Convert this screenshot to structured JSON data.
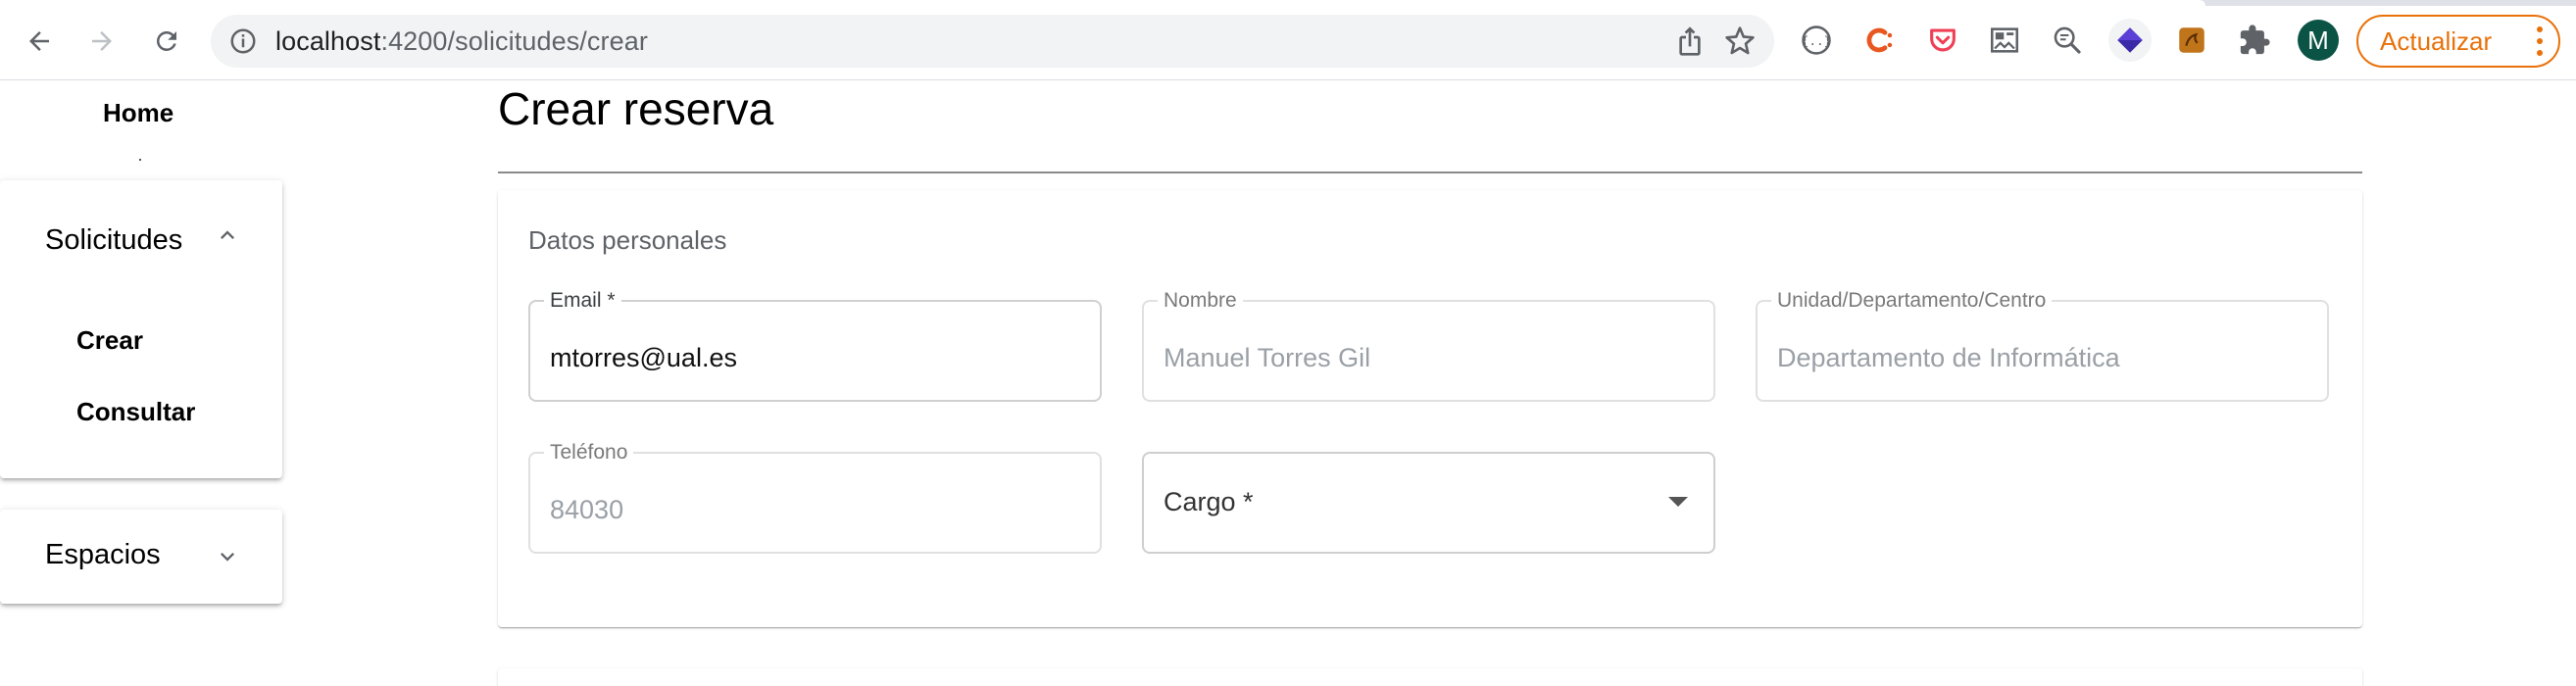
{
  "browser": {
    "url_host": "localhost",
    "url_path": ":4200/solicitudes/crear",
    "profile_initial": "M",
    "update_label": "Actualizar",
    "extensions": [
      "code-braces-icon",
      "clockify-icon",
      "pocket-icon",
      "gallery-icon",
      "zoom-text-icon",
      "diamond-icon",
      "amber-icon",
      "puzzle-icon"
    ],
    "accent_color": "#e8710a",
    "profile_color": "#0b5345"
  },
  "sidebar": {
    "home_label": "Home",
    "solicitudes": {
      "title": "Solicitudes",
      "expanded": true,
      "items": [
        {
          "label": "Crear"
        },
        {
          "label": "Consultar"
        }
      ]
    },
    "espacios": {
      "title": "Espacios",
      "expanded": false
    }
  },
  "main": {
    "title": "Crear reserva",
    "section_title": "Datos personales",
    "fields": {
      "email": {
        "label": "Email *",
        "value": "mtorres@ual.es"
      },
      "nombre": {
        "label": "Nombre",
        "value": "Manuel Torres Gil"
      },
      "unidad": {
        "label": "Unidad/Departamento/Centro",
        "value": "Departamento de Informática"
      },
      "telefono": {
        "label": "Teléfono",
        "value": "84030"
      },
      "cargo": {
        "label": "Cargo *"
      }
    }
  }
}
